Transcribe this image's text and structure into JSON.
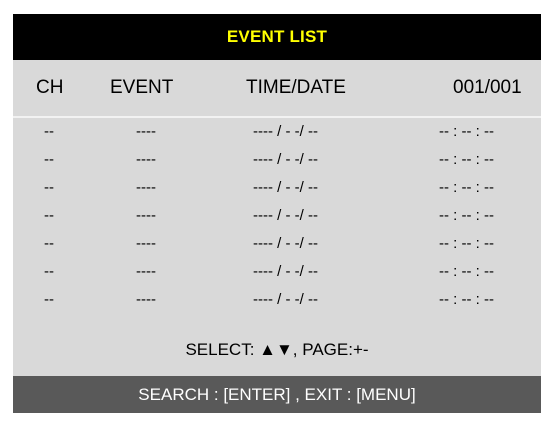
{
  "title": "EVENT LIST",
  "columns": {
    "ch": "CH",
    "event": "EVENT",
    "time_date": "TIME/DATE",
    "page": "001/001"
  },
  "rows": [
    {
      "ch": "--",
      "event": "----",
      "date": "---- / - -/ --",
      "time": "-- : -- : --"
    },
    {
      "ch": "--",
      "event": "----",
      "date": "---- / - -/ --",
      "time": "-- : -- : --"
    },
    {
      "ch": "--",
      "event": "----",
      "date": "---- / - -/ --",
      "time": "-- : -- : --"
    },
    {
      "ch": "--",
      "event": "----",
      "date": "---- / - -/ --",
      "time": "-- : -- : --"
    },
    {
      "ch": "--",
      "event": "----",
      "date": "---- / - -/ --",
      "time": "-- : -- : --"
    },
    {
      "ch": "--",
      "event": "----",
      "date": "---- / - -/ --",
      "time": "-- : -- : --"
    },
    {
      "ch": "--",
      "event": "----",
      "date": "---- / - -/ --",
      "time": "-- : -- : --"
    }
  ],
  "select_hint": "SELECT: ▲▼, PAGE:+-",
  "footer": "SEARCH : [ENTER] , EXIT : [MENU]",
  "colors": {
    "title_bg": "#000000",
    "title_text": "#ffff00",
    "panel_bg": "#d9d9d9",
    "footer_bg": "#595959",
    "footer_text": "#ffffff"
  }
}
